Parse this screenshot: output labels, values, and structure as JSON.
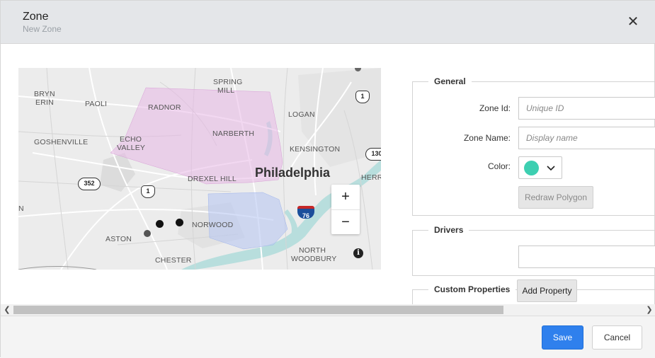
{
  "dialog": {
    "title": "Zone",
    "subtitle": "New Zone",
    "close_icon": "close-icon"
  },
  "map": {
    "labels": {
      "spring_mill_1": "SPRING",
      "spring_mill_2": "MILL",
      "bryn_erin_1": "BRYN",
      "bryn_erin_2": "ERIN",
      "paoli": "PAOLI",
      "radnor": "RADNOR",
      "logan": "LOGAN",
      "goshenville": "GOSHENVILLE",
      "echo_valley_1": "ECHO",
      "echo_valley_2": "VALLEY",
      "narberth": "NARBERTH",
      "kensington": "KENSINGTON",
      "drexel_hill": "DREXEL HILL",
      "philadelphia": "Philadelphia",
      "norwood": "NORWOOD",
      "aston": "ASTON",
      "chester": "CHESTER",
      "north_woodbury_1": "NORTH",
      "north_woodbury_2": "WOODBURY",
      "cherry": "HERRY",
      "edge_n": "N"
    },
    "shields": {
      "us1_top": "1",
      "us1_mid": "1",
      "route352": "352",
      "route130": "130",
      "i76": "76"
    },
    "zoom_in": "+",
    "zoom_out": "−",
    "info": "i",
    "colors": {
      "zone1_fill": "#e7b8e6",
      "zone2_fill": "#b9c8f2",
      "water": "#b8dedd"
    }
  },
  "general": {
    "legend": "General",
    "zone_id_label": "Zone Id:",
    "zone_id_placeholder": "Unique ID",
    "zone_id_value": "",
    "zone_name_label": "Zone Name:",
    "zone_name_placeholder": "Display name",
    "zone_name_value": "",
    "color_label": "Color:",
    "color_value": "#3dcfb1",
    "redraw_button": "Redraw Polygon"
  },
  "drivers": {
    "legend": "Drivers",
    "value": ""
  },
  "custom_properties": {
    "legend": "Custom Properties",
    "add_button": "Add Property"
  },
  "scroll": {
    "left_arrow": "❮",
    "right_arrow": "❯"
  },
  "footer": {
    "save_label": "Save",
    "cancel_label": "Cancel",
    "save_color": "#2f80ed"
  }
}
